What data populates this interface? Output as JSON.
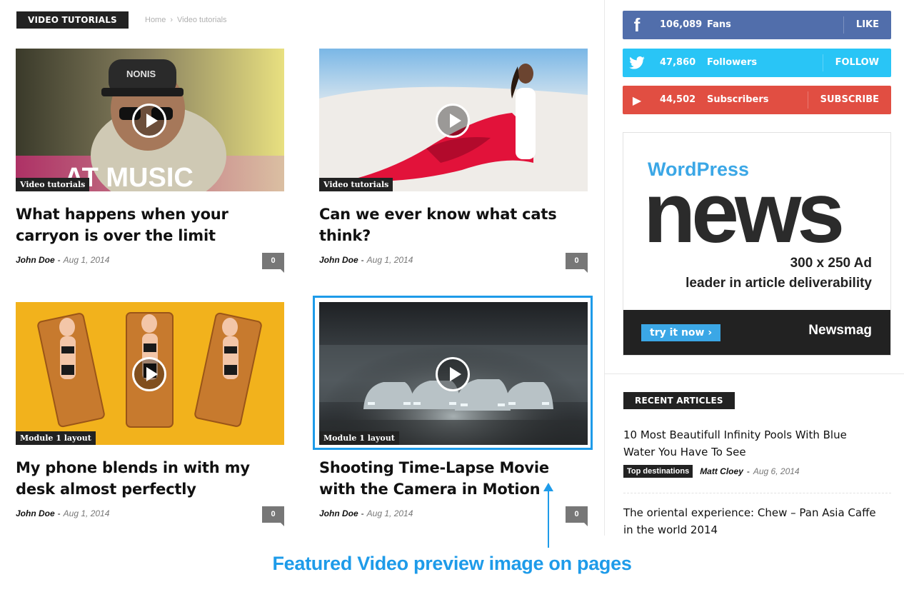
{
  "section": {
    "title": "VIDEO TUTORIALS"
  },
  "breadcrumb": {
    "home": "Home",
    "separator": "›",
    "current": "Video tutorials"
  },
  "articles": [
    {
      "category": "Video tutorials",
      "title": "What happens when your carryon is over the limit",
      "author": "John Doe",
      "date": "Aug 1, 2014",
      "comments": "0",
      "thumb_text": "AT MUSIC",
      "cap_text": "NONIS"
    },
    {
      "category": "Video tutorials",
      "title": "Can we ever know what cats think?",
      "author": "John Doe",
      "date": "Aug 1, 2014",
      "comments": "0"
    },
    {
      "category": "Module 1 layout",
      "title": "My phone blends in with my desk almost perfectly",
      "author": "John Doe",
      "date": "Aug 1, 2014",
      "comments": "0"
    },
    {
      "category": "Module 1 layout",
      "title": "Shooting Time-Lapse Movie with the Camera in Motion",
      "author": "John Doe",
      "date": "Aug 1, 2014",
      "comments": "0"
    }
  ],
  "social": [
    {
      "icon": "facebook-icon",
      "glyph": "f",
      "count": "106,089",
      "label": "Fans",
      "action": "LIKE",
      "color": "#516eab"
    },
    {
      "icon": "twitter-icon",
      "glyph": "🐦",
      "count": "47,860",
      "label": "Followers",
      "action": "FOLLOW",
      "color": "#29c5f6"
    },
    {
      "icon": "youtube-icon",
      "glyph": "▶",
      "count": "44,502",
      "label": "Subscribers",
      "action": "SUBSCRIBE",
      "color": "#e14e42"
    }
  ],
  "ad": {
    "brand_top": "WordPress",
    "headline": "news",
    "size": "300 x 250 Ad",
    "tagline": "leader in article deliverability",
    "cta": "try it now",
    "cta_icon": "›",
    "brand": "Newsmag"
  },
  "recent": {
    "title": "RECENT ARTICLES",
    "items": [
      {
        "title": "10 Most Beautifull Infinity Pools With Blue Water You Have To See",
        "tag": "Top destinations",
        "author": "Matt Cloey",
        "date": "Aug 6, 2014"
      },
      {
        "title": "The oriental experience: Chew – Pan Asia Caffe in the world 2014"
      }
    ]
  },
  "caption": "Featured Video preview image on pages",
  "colors": {
    "accent": "#1e9be9",
    "dark": "#222222"
  }
}
